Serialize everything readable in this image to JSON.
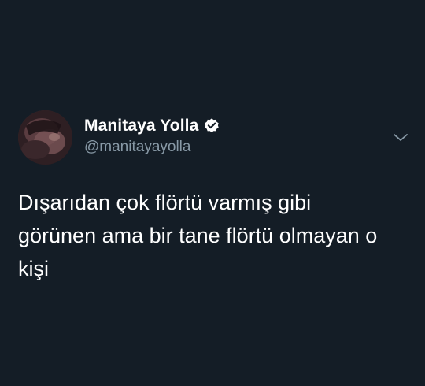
{
  "tweet": {
    "display_name": "Manitaya Yolla",
    "handle": "@manitayayolla",
    "verified_icon": "verified-badge-icon",
    "menu_icon": "chevron-down-icon",
    "text": "Dışarıdan çok flörtü varmış gibi\ngörünen ama bir tane flörtü olmayan o\nkişi"
  },
  "colors": {
    "background": "#141d26",
    "text_primary": "#ffffff",
    "text_secondary": "#8899a6",
    "icon_muted": "#8899a6"
  }
}
